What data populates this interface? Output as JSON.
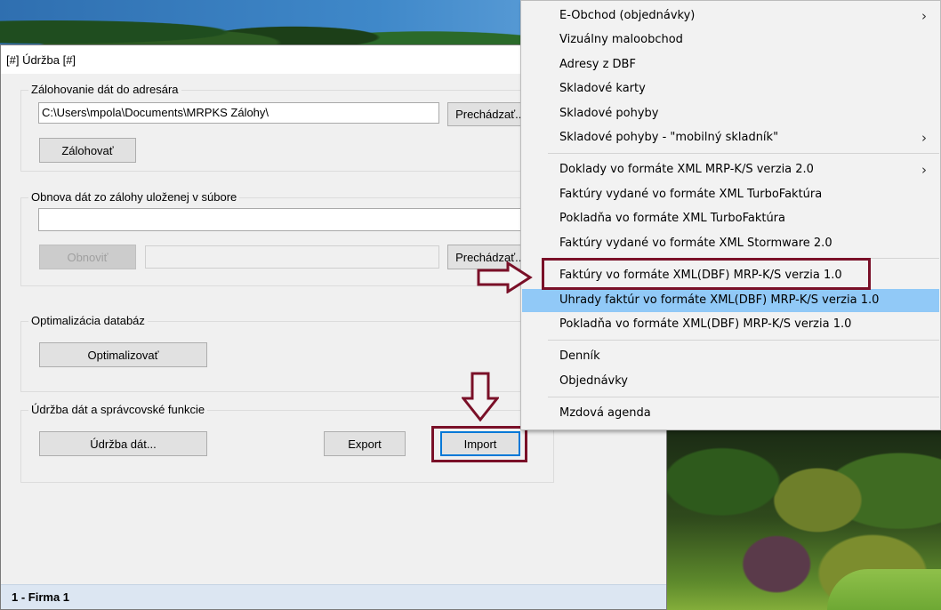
{
  "window": {
    "title": "[#] Údržba [#]",
    "status": "1 - Firma 1"
  },
  "backup": {
    "group_label": "Zálohovanie dát do adresára",
    "path_value": "C:\\Users\\mpola\\Documents\\MRPKS Zálohy\\",
    "browse_label": "Prechádzať...",
    "backup_label": "Zálohovať"
  },
  "restore": {
    "group_label": "Obnova dát zo zálohy uloženej v súbore",
    "list_value": "",
    "restore_label": "Obnoviť",
    "file_value": "",
    "browse_label": "Prechádzať..."
  },
  "optimize": {
    "group_label": "Optimalizácia databáz",
    "button_label": "Optimalizovať"
  },
  "maintenance": {
    "group_label": "Údržba dát a správcovské funkcie",
    "maintenance_label": "Údržba dát...",
    "export_label": "Export",
    "import_label": "Import"
  },
  "menu": {
    "items": [
      {
        "label": "E-Obchod (objednávky)",
        "submenu": true
      },
      {
        "label": "Vizuálny maloobchod"
      },
      {
        "label": "Adresy z DBF"
      },
      {
        "label": "Skladové karty"
      },
      {
        "label": "Skladové pohyby"
      },
      {
        "label": "Skladové pohyby - \"mobilný skladník\"",
        "submenu": true
      },
      {
        "label": "Doklady vo formáte XML MRP-K/S verzia 2.0",
        "submenu": true
      },
      {
        "label": "Faktúry vydané vo formáte XML TurboFaktúra"
      },
      {
        "label": "Pokladňa vo formáte XML TurboFaktúra"
      },
      {
        "label": "Faktúry vydané vo formáte XML Stormware 2.0"
      },
      {
        "label": "Faktúry vo formáte XML(DBF) MRP-K/S verzia 1.0"
      },
      {
        "label": "Uhrady faktúr vo formáte XML(DBF) MRP-K/S verzia 1.0",
        "highlighted": true
      },
      {
        "label": "Pokladňa vo formáte XML(DBF) MRP-K/S verzia 1.0"
      },
      {
        "label": "Denník"
      },
      {
        "label": "Objednávky"
      },
      {
        "label": "Mzdová agenda"
      }
    ],
    "submenu_glyph": "›"
  },
  "colors": {
    "highlight": "#91c9f7",
    "annotation": "#7a1028",
    "focus": "#0078d7"
  },
  "icons": [
    "arrow-right-annotation-icon",
    "arrow-down-annotation-icon",
    "chevron-right-icon"
  ]
}
